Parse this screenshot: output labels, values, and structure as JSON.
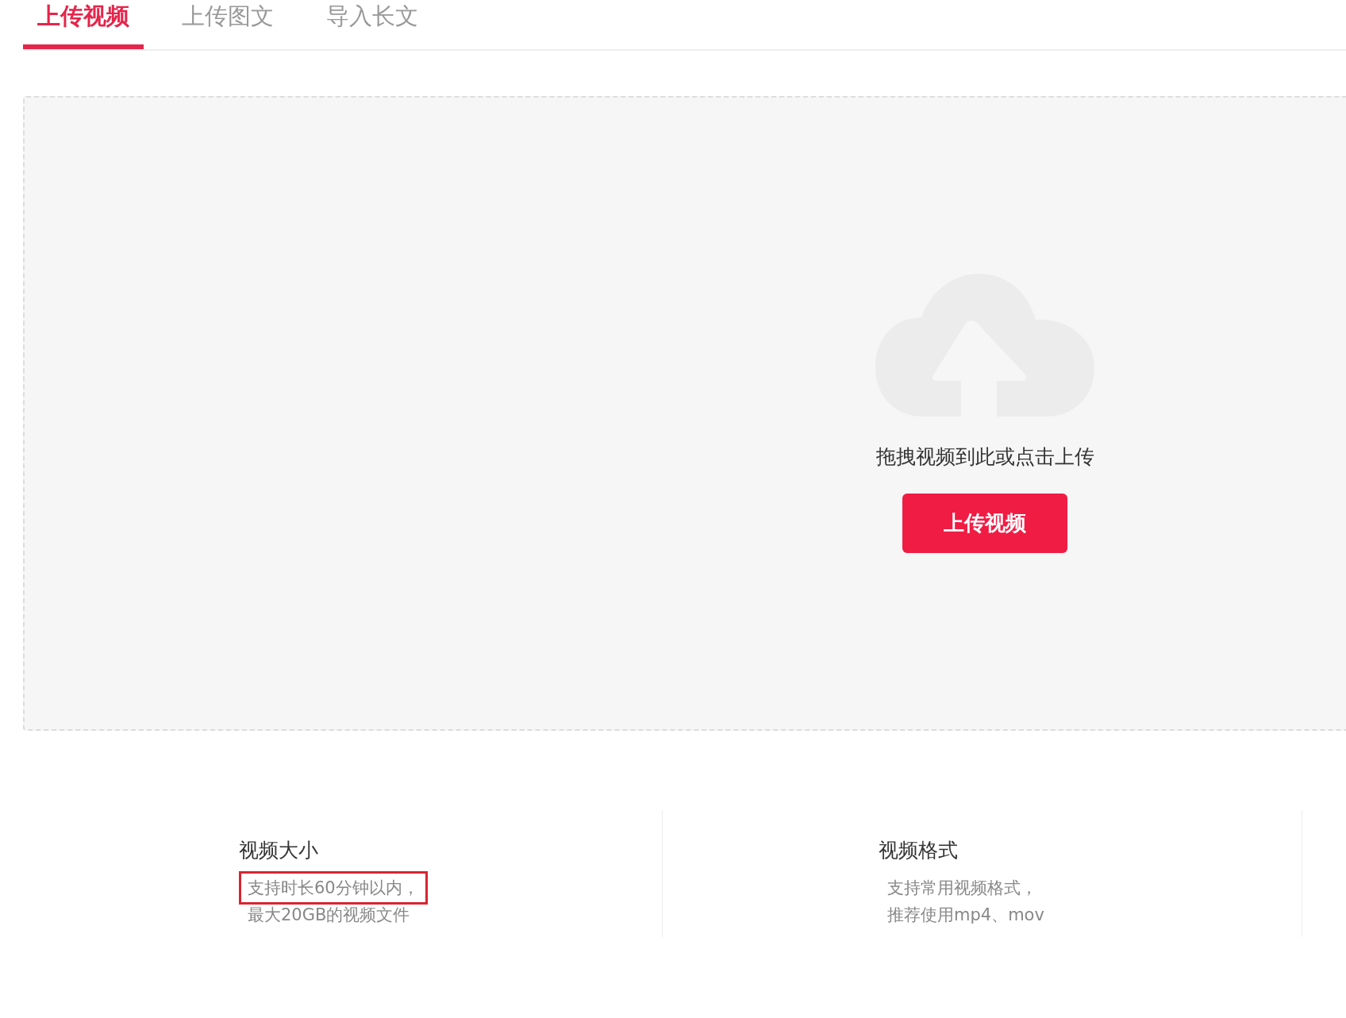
{
  "tabs": [
    {
      "label": "上传视频",
      "selected": true
    },
    {
      "label": "上传图文",
      "selected": false
    },
    {
      "label": "导入长文",
      "selected": false
    }
  ],
  "dropzone": {
    "hint": "拖拽视频到此或点击上传",
    "button": "上传视频"
  },
  "info": [
    {
      "title": "视频大小",
      "lines": [
        {
          "text": "支持时长60分钟以内，",
          "highlighted": true
        },
        {
          "text": "最大20GB的视频文件",
          "highlighted": false
        }
      ]
    },
    {
      "title": "视频格式",
      "lines": [
        {
          "text": "支持常用视频格式，",
          "highlighted": false
        },
        {
          "text": "推荐使用mp4、mov",
          "highlighted": false
        }
      ]
    }
  ]
}
